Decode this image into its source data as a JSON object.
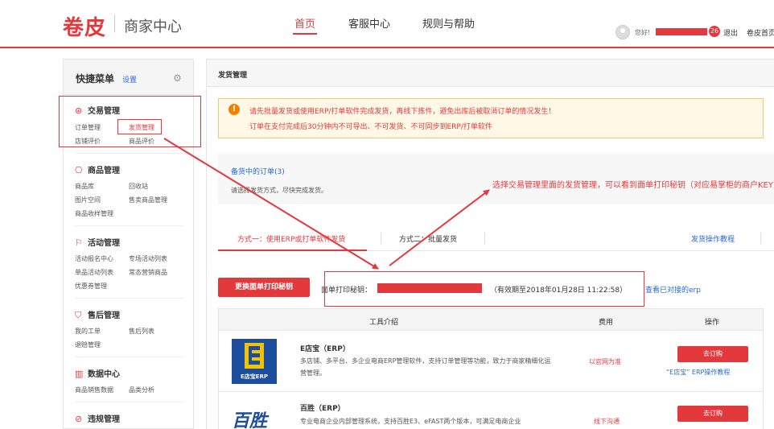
{
  "header": {
    "logo": "卷皮",
    "subtitle": "商家中心",
    "nav": [
      {
        "label": "首页",
        "active": true
      },
      {
        "label": "客服中心",
        "active": false
      },
      {
        "label": "规则与帮助",
        "active": false
      }
    ],
    "greeting": "您好!",
    "message_count": "26",
    "logout": "退出",
    "home": "卷皮首页"
  },
  "sidebar": {
    "title": "快捷菜单",
    "settings": "设置",
    "sections": [
      {
        "title": "交易管理",
        "icon": "trade-icon",
        "links": [
          "订单管理",
          "发货管理",
          "店铺评价",
          "商品评价"
        ]
      },
      {
        "title": "商品管理",
        "icon": "product-icon",
        "links": [
          "商品库",
          "回收站",
          "图片空间",
          "售卖商品管理",
          "商品收样管理"
        ]
      },
      {
        "title": "活动管理",
        "icon": "flag-icon",
        "links": [
          "活动报名中心",
          "专场活动列表",
          "单品活动列表",
          "常态营销商品",
          "优惠券管理"
        ]
      },
      {
        "title": "售后管理",
        "icon": "shield-icon",
        "links": [
          "我的工单",
          "售后列表",
          "退赔管理"
        ]
      },
      {
        "title": "数据中心",
        "icon": "chart-icon",
        "links": [
          "商品销售数据",
          "品类分析"
        ]
      },
      {
        "title": "违规管理",
        "icon": "ban-icon",
        "links": []
      }
    ]
  },
  "main": {
    "title": "发货管理",
    "warning": {
      "line1": "请先批量发货或使用ERP/打单软件完成发货，再线下拣件，避免出库后被取消订单的情况发生！",
      "line2": "订单在支付完成后30分钟内不可导出、不可发货、不可同步到ERP/打单软件"
    },
    "pending": {
      "title": "备货中的订单(3)",
      "subtitle": "请选择发货方式，尽快完成发货。"
    },
    "tabs": {
      "tab1": "方式一：使用ERP或打单软件发货",
      "tab2": "方式二：批量发货",
      "tutorial": "发货操作教程"
    },
    "key": {
      "button": "更换面单打印秘钥",
      "label": "面单打印秘钥：",
      "validity": "（有效期至2018年01月28日 11:22:58）",
      "erp_link": "查看已对接的erp"
    },
    "table": {
      "headers": [
        "工具介绍",
        "费用",
        "操作"
      ],
      "rows": [
        {
          "logo_text": "E店宝ERP",
          "name": "E店宝（ERP）",
          "desc": "多店铺、多平台、多企业电商ERP管理软件，支持订单管理等功能，致力于商家精细化运营管理。",
          "fee": "以官网为准",
          "buy": "去订购",
          "tutorial": "“E店宝” ERP操作教程"
        },
        {
          "logo_text": "百胜",
          "name": "百胜（ERP）",
          "desc": "专业电商企业内部管理系统，支持百胜E3、eFAST两个版本，可满足电商企业",
          "fee": "线下沟通",
          "buy": "去订购",
          "tutorial": ""
        }
      ]
    }
  },
  "annotation": {
    "text": "选择交易管理里面的发货管理，可以看到面单打印秘钥（对应易掌柜的商户KEY）"
  },
  "colors": {
    "brand": "#e4393c",
    "link": "#2a6ad0",
    "warn_bg": "#fff8e6",
    "warn_icon": "#f08200"
  }
}
